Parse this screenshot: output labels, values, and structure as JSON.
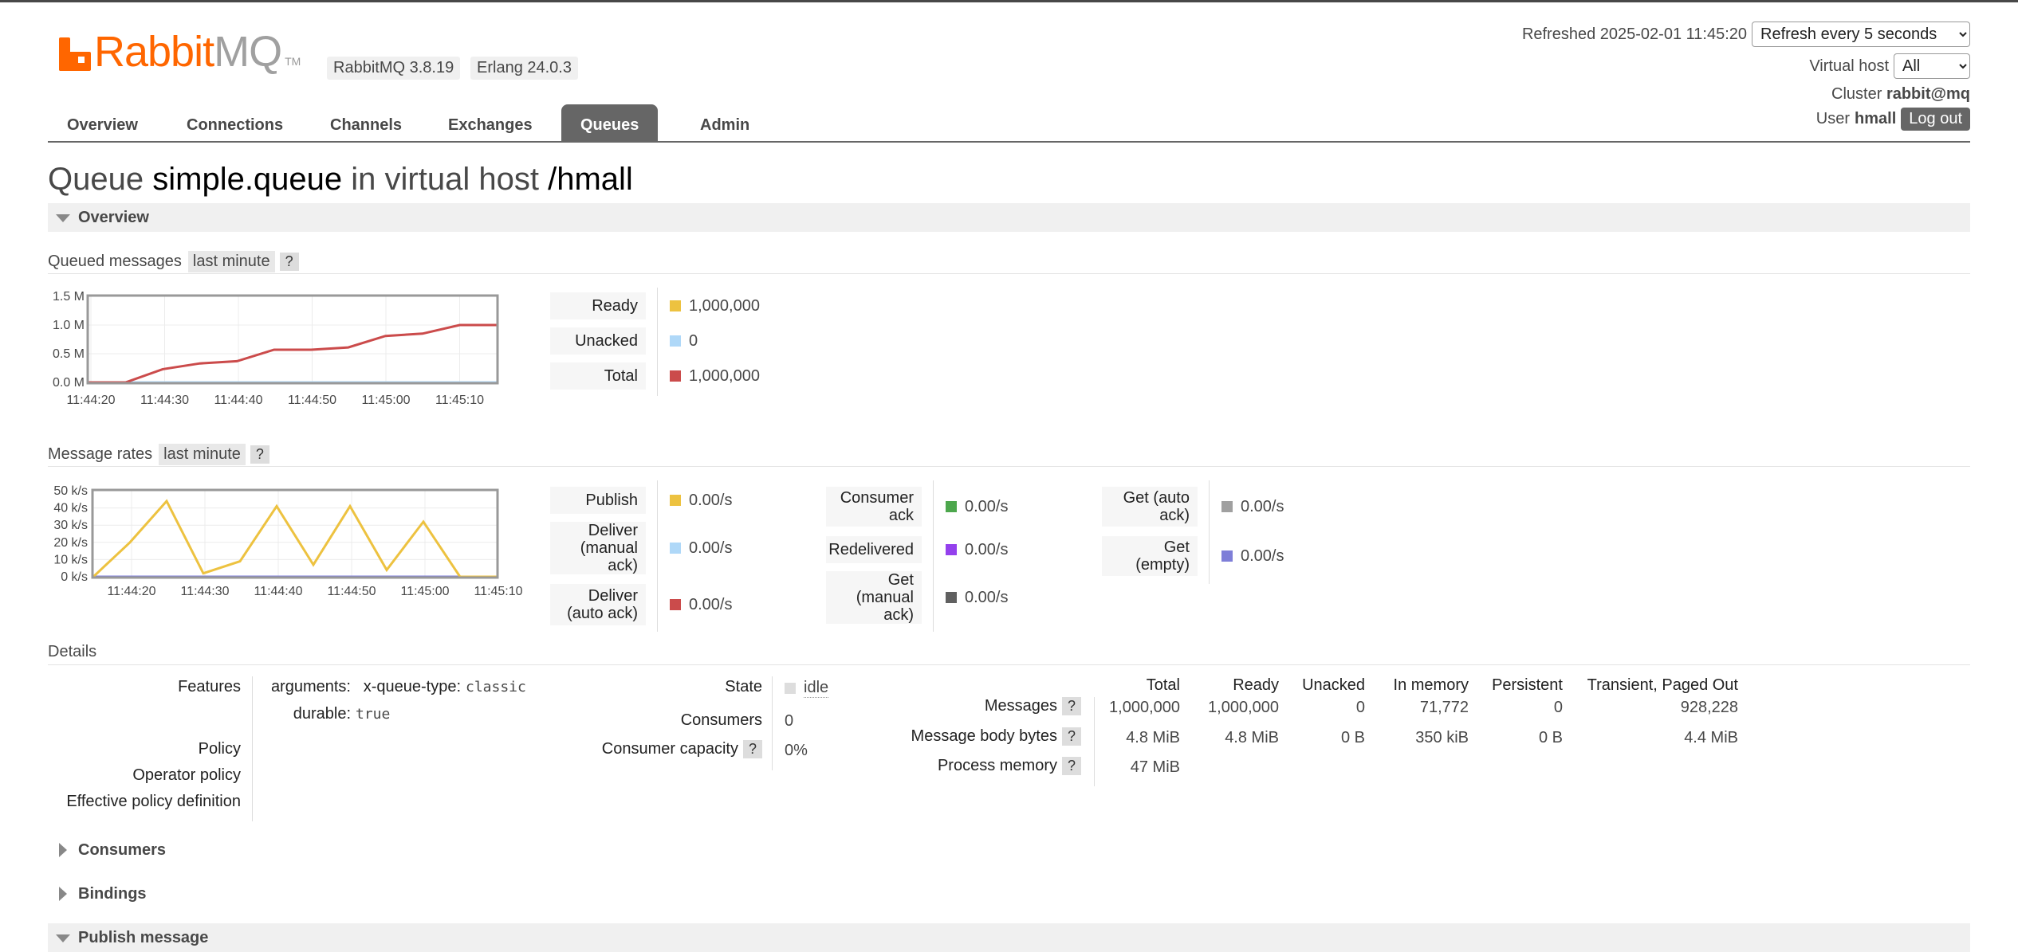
{
  "header": {
    "logo": {
      "rabbit": "Rabbit",
      "mq": "MQ",
      "tm": "TM"
    },
    "rabbitmq_version": "RabbitMQ 3.8.19",
    "erlang_version": "Erlang 24.0.3",
    "refreshed_label": "Refreshed 2025-02-01 11:45:20",
    "refresh_select": "Refresh every 5 seconds",
    "vhost_label": "Virtual host",
    "vhost_select": "All",
    "cluster_label": "Cluster",
    "cluster_name": "rabbit@mq",
    "user_label": "User",
    "user_name": "hmall",
    "logout": "Log out"
  },
  "tabs": [
    "Overview",
    "Connections",
    "Channels",
    "Exchanges",
    "Queues",
    "Admin"
  ],
  "active_tab": "Queues",
  "title": {
    "pre": "Queue",
    "queue": "simple.queue",
    "mid": "in virtual host",
    "vhost": "/hmall"
  },
  "sections": {
    "overview": "Overview",
    "consumers": "Consumers",
    "bindings": "Bindings",
    "publish": "Publish message"
  },
  "queued": {
    "label": "Queued messages",
    "range": "last minute",
    "help": "?",
    "legend": [
      {
        "label": "Ready",
        "value": "1,000,000",
        "color": "#edc240"
      },
      {
        "label": "Unacked",
        "value": "0",
        "color": "#afd8f8"
      },
      {
        "label": "Total",
        "value": "1,000,000",
        "color": "#cb4b4b"
      }
    ]
  },
  "rates": {
    "label": "Message rates",
    "range": "last minute",
    "help": "?",
    "col1": [
      {
        "label": "Publish",
        "value": "0.00/s",
        "color": "#edc240"
      },
      {
        "label": "Deliver (manual ack)",
        "value": "0.00/s",
        "color": "#afd8f8"
      },
      {
        "label": "Deliver (auto ack)",
        "value": "0.00/s",
        "color": "#cb4b4b"
      }
    ],
    "col2": [
      {
        "label": "Consumer ack",
        "value": "0.00/s",
        "color": "#4da74d"
      },
      {
        "label": "Redelivered",
        "value": "0.00/s",
        "color": "#9440ed"
      },
      {
        "label": "Get (manual ack)",
        "value": "0.00/s",
        "color": "#606060"
      }
    ],
    "col3": [
      {
        "label": "Get (auto ack)",
        "value": "0.00/s",
        "color": "#a0a0a0"
      },
      {
        "label": "Get (empty)",
        "value": "0.00/s",
        "color": "#7e7ed8"
      }
    ]
  },
  "chart_data": [
    {
      "type": "line",
      "x": [
        "11:44:20",
        "11:44:25",
        "11:44:30",
        "11:44:35",
        "11:44:40",
        "11:44:45",
        "11:44:50",
        "11:44:55",
        "11:45:00",
        "11:45:05",
        "11:45:10",
        "11:45:15"
      ],
      "x_ticks": [
        "11:44:20",
        "11:44:30",
        "11:44:40",
        "11:44:50",
        "11:45:00",
        "11:45:10"
      ],
      "y_ticks": [
        "1.5 M",
        "1.0 M",
        "0.5 M",
        "0.0 M"
      ],
      "ylim": [
        0,
        1500000
      ],
      "series": [
        {
          "color": "#cb4b4b",
          "values": [
            0,
            0,
            230000,
            330000,
            370000,
            570000,
            570000,
            610000,
            810000,
            850000,
            1000000,
            1000000
          ]
        },
        {
          "color": "#afd8f8",
          "values": [
            0,
            0,
            0,
            0,
            0,
            0,
            0,
            0,
            0,
            0,
            0,
            0
          ]
        }
      ]
    },
    {
      "type": "line",
      "x": [
        "11:44:15",
        "11:44:20",
        "11:44:25",
        "11:44:30",
        "11:44:35",
        "11:44:40",
        "11:44:45",
        "11:44:50",
        "11:44:55",
        "11:45:00",
        "11:45:05",
        "11:45:10"
      ],
      "x_ticks": [
        "11:44:20",
        "11:44:30",
        "11:44:40",
        "11:44:50",
        "11:45:00",
        "11:45:10"
      ],
      "y_ticks": [
        "50 k/s",
        "40 k/s",
        "30 k/s",
        "20 k/s",
        "10 k/s",
        "0 k/s"
      ],
      "ylim": [
        0,
        50000
      ],
      "series": [
        {
          "color": "#edc240",
          "values": [
            0,
            20000,
            44000,
            2000,
            9000,
            41000,
            7000,
            41000,
            4000,
            32000,
            0,
            0
          ]
        },
        {
          "color": "#7e7ed8",
          "values": [
            0,
            0,
            0,
            0,
            0,
            0,
            0,
            0,
            0,
            0,
            0,
            0
          ]
        }
      ]
    }
  ],
  "details": {
    "label": "Details",
    "features_label": "Features",
    "arguments_key": "arguments:",
    "xqt_key": "x-queue-type:",
    "xqt_value": "classic",
    "durable_key": "durable:",
    "durable_value": "true",
    "policy_label": "Policy",
    "operator_policy_label": "Operator policy",
    "effective_policy_label": "Effective policy definition",
    "state_label": "State",
    "state_value": "idle",
    "consumers_label": "Consumers",
    "consumers_value": "0",
    "capacity_label": "Consumer capacity",
    "capacity_help": "?",
    "capacity_value": "0%",
    "table": {
      "headers": [
        "Total",
        "Ready",
        "Unacked",
        "In memory",
        "Persistent",
        "Transient, Paged Out"
      ],
      "rows": [
        {
          "label": "Messages",
          "help": "?",
          "cells": [
            "1,000,000",
            "1,000,000",
            "0",
            "71,772",
            "0",
            "928,228"
          ]
        },
        {
          "label": "Message body bytes",
          "help": "?",
          "cells": [
            "4.8 MiB",
            "4.8 MiB",
            "0 B",
            "350 kiB",
            "0 B",
            "4.4 MiB"
          ]
        },
        {
          "label": "Process memory",
          "help": "?",
          "cells": [
            "47 MiB",
            "",
            "",
            "",
            "",
            ""
          ]
        }
      ]
    }
  }
}
